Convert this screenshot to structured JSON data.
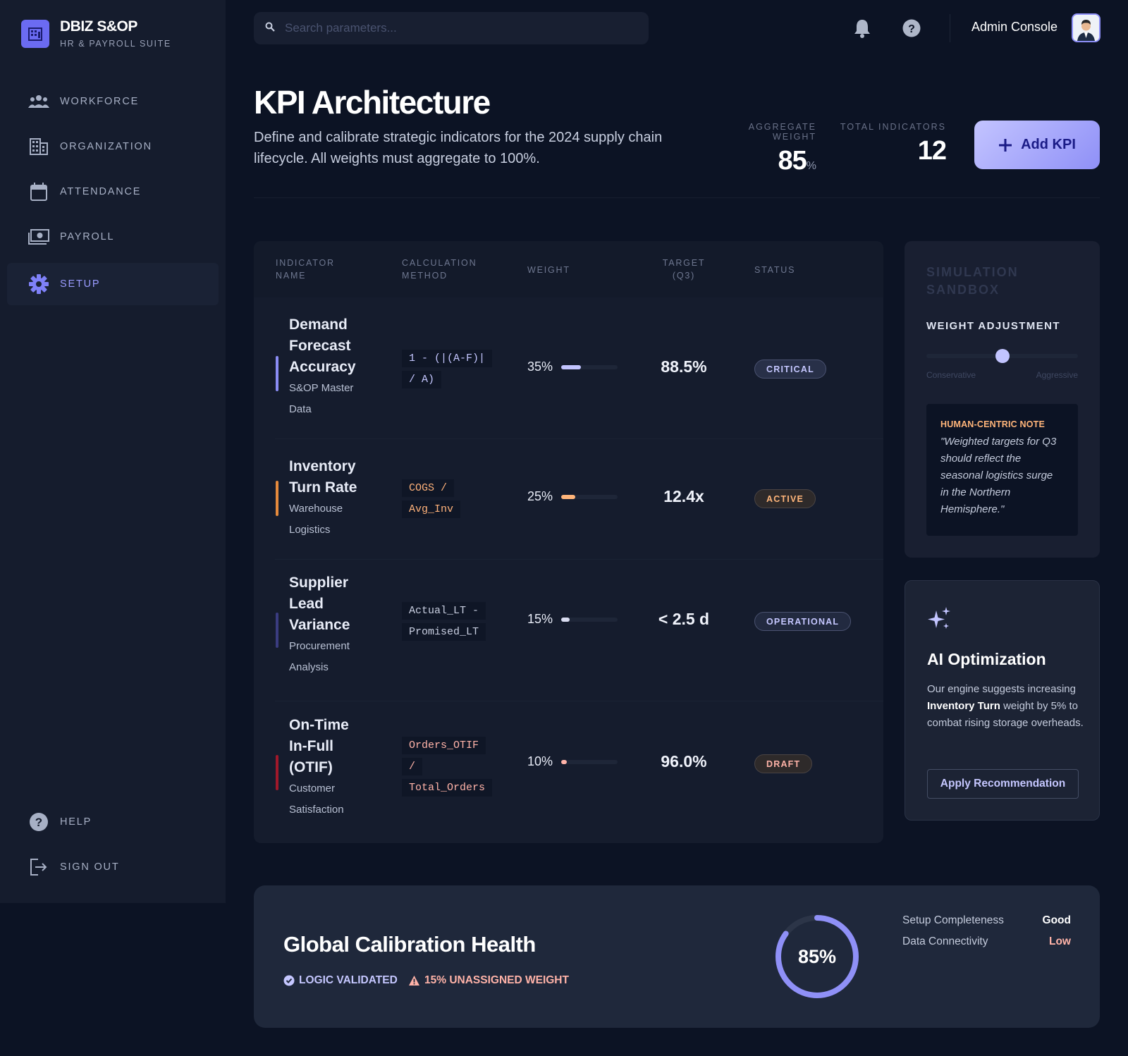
{
  "brand": {
    "title": "DBIZ S&OP",
    "subtitle": "HR & PAYROLL SUITE"
  },
  "nav": {
    "items": [
      {
        "label": "WORKFORCE",
        "icon": "people-icon"
      },
      {
        "label": "ORGANIZATION",
        "icon": "building-icon"
      },
      {
        "label": "ATTENDANCE",
        "icon": "calendar-icon"
      },
      {
        "label": "PAYROLL",
        "icon": "cash-icon"
      },
      {
        "label": "SETUP",
        "icon": "gear-icon",
        "active": true
      }
    ],
    "bottom": [
      {
        "label": "HELP",
        "icon": "help-icon"
      },
      {
        "label": "SIGN OUT",
        "icon": "sign-out-icon"
      }
    ]
  },
  "topbar": {
    "search_placeholder": "Search parameters...",
    "user_label": "Admin Console"
  },
  "header": {
    "title": "KPI Architecture",
    "description": "Define and calibrate strategic indicators for the 2024 supply chain lifecycle. All weights must aggregate to 100%.",
    "aggregate_weight_label": "AGGREGATE WEIGHT",
    "aggregate_weight_value": "85",
    "aggregate_weight_unit": "%",
    "total_indicators_label": "TOTAL INDICATORS",
    "total_indicators_value": "12",
    "add_button": "Add KPI"
  },
  "table": {
    "headers": {
      "name": [
        "INDICATOR",
        "NAME"
      ],
      "method": [
        "CALCULATION",
        "METHOD"
      ],
      "weight": "WEIGHT",
      "target": [
        "TARGET",
        "(Q3)"
      ],
      "status": "STATUS"
    },
    "rows": [
      {
        "name": [
          "Demand",
          "Forecast",
          "Accuracy"
        ],
        "source": [
          "S&OP Master",
          "Data"
        ],
        "method": [
          "1 - (|(A-F)|",
          "/ A)"
        ],
        "method_color": "#c4c6ff",
        "weight": 35,
        "weight_label": "35%",
        "target": "88.5%",
        "status": "CRITICAL",
        "accent": "#8a8cf4"
      },
      {
        "name": [
          "Inventory",
          "Turn Rate"
        ],
        "source": [
          "Warehouse",
          "Logistics"
        ],
        "method": [
          "COGS /",
          "Avg_Inv"
        ],
        "method_color": "#ffb27a",
        "weight": 25,
        "weight_label": "25%",
        "target": "12.4x",
        "status": "ACTIVE",
        "accent": "#e58a3c"
      },
      {
        "name": [
          "Supplier",
          "Lead",
          "Variance"
        ],
        "source": [
          "Procurement",
          "Analysis"
        ],
        "method": [
          "Actual_LT -",
          "Promised_LT"
        ],
        "method_color": "#c8cee0",
        "weight": 15,
        "weight_label": "15%",
        "target": "< 2.5 d",
        "status": "OPERATIONAL",
        "accent": "#3a3c80"
      },
      {
        "name": [
          "On-Time",
          "In-Full",
          "(OTIF)"
        ],
        "source": [
          "Customer",
          "Satisfaction"
        ],
        "method": [
          "Orders_OTIF",
          "/",
          "Total_Orders"
        ],
        "method_color": "#ffb3a8",
        "weight": 10,
        "weight_label": "10%",
        "target": "96.0%",
        "status": "DRAFT",
        "accent": "#a0182a"
      }
    ]
  },
  "sandbox": {
    "title": [
      "SIMULATION",
      "SANDBOX"
    ],
    "weight_adjustment": "WEIGHT ADJUSTMENT",
    "slider_value": 0.5,
    "min_label": "Conservative",
    "max_label": "Aggressive",
    "note_title": "HUMAN-CENTRIC NOTE",
    "note_text": "\"Weighted targets for Q3 should reflect the seasonal logistics surge in the Northern Hemisphere.\""
  },
  "ai": {
    "title": "AI Optimization",
    "text_before": "Our engine suggests increasing ",
    "text_bold": "Inventory Turn",
    "text_after": " weight by 5% to combat rising storage overheads.",
    "button": "Apply Recommendation"
  },
  "health": {
    "title": "Global Calibration Health",
    "tag_validated": "LOGIC VALIDATED",
    "tag_warning": "15% UNASSIGNED WEIGHT",
    "ring_value": 85,
    "ring_label": "85%",
    "metrics": [
      {
        "label": "Setup Completeness",
        "value": "Good",
        "color": "#ffffff"
      },
      {
        "label": "Data Connectivity",
        "value": "Low",
        "color": "#ffb3a8"
      }
    ]
  },
  "colors": {
    "accent": "#8f90f7",
    "warning": "#ffb3a8",
    "orange": "#ffb57a"
  }
}
